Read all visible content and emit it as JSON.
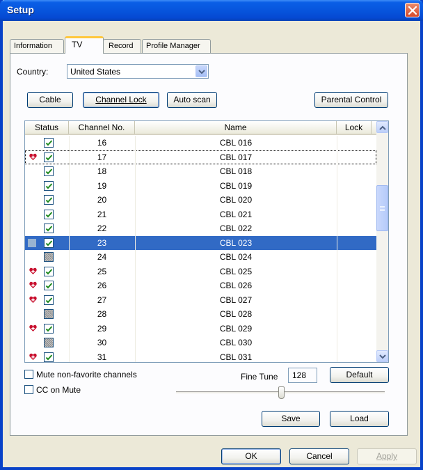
{
  "window": {
    "title": "Setup"
  },
  "tabs": [
    {
      "label": "Information"
    },
    {
      "label": "TV"
    },
    {
      "label": "Record"
    },
    {
      "label": "Profile Manager"
    }
  ],
  "country": {
    "label": "Country:",
    "value": "United States"
  },
  "buttons": {
    "cable": "Cable",
    "channel_lock": "Channel Lock",
    "auto_scan": "Auto scan",
    "parental_control": "Parental Control",
    "default": "Default",
    "save": "Save",
    "load": "Load",
    "ok": "OK",
    "cancel": "Cancel",
    "apply": "Apply"
  },
  "list": {
    "headers": {
      "status": "Status",
      "channel": "Channel No.",
      "name": "Name",
      "lock": "Lock"
    },
    "rows": [
      {
        "favorite": false,
        "checked": true,
        "channel": "16",
        "name": "CBL 016"
      },
      {
        "favorite": true,
        "checked": true,
        "channel": "17",
        "name": "CBL 017",
        "focused": true
      },
      {
        "favorite": false,
        "checked": true,
        "channel": "18",
        "name": "CBL 018"
      },
      {
        "favorite": false,
        "checked": true,
        "channel": "19",
        "name": "CBL 019"
      },
      {
        "favorite": false,
        "checked": true,
        "channel": "20",
        "name": "CBL 020"
      },
      {
        "favorite": false,
        "checked": true,
        "channel": "21",
        "name": "CBL 021"
      },
      {
        "favorite": false,
        "checked": true,
        "channel": "22",
        "name": "CBL 022"
      },
      {
        "favorite": false,
        "checked": true,
        "channel": "23",
        "name": "CBL 023",
        "selected": true
      },
      {
        "favorite": false,
        "checked": false,
        "channel": "24",
        "name": "CBL 024"
      },
      {
        "favorite": true,
        "checked": true,
        "channel": "25",
        "name": "CBL 025"
      },
      {
        "favorite": true,
        "checked": true,
        "channel": "26",
        "name": "CBL 026"
      },
      {
        "favorite": true,
        "checked": true,
        "channel": "27",
        "name": "CBL 027"
      },
      {
        "favorite": false,
        "checked": false,
        "channel": "28",
        "name": "CBL 028"
      },
      {
        "favorite": true,
        "checked": true,
        "channel": "29",
        "name": "CBL 029"
      },
      {
        "favorite": false,
        "checked": false,
        "channel": "30",
        "name": "CBL 030"
      },
      {
        "favorite": true,
        "checked": true,
        "channel": "31",
        "name": "CBL 031"
      }
    ]
  },
  "options": {
    "mute_nonfavorite": {
      "label": "Mute non-favorite channels",
      "checked": false
    },
    "cc_on_mute": {
      "label": "CC on Mute",
      "checked": false
    }
  },
  "fine_tune": {
    "label": "Fine Tune",
    "value": "128"
  },
  "colors": {
    "title_bar": "#0755dd",
    "selection": "#316ac5",
    "favorite_heart": "#c8102e",
    "check_mark": "#1f8a1f"
  },
  "icons": {
    "close": "close-icon",
    "favorite": "heart-icon",
    "check": "checkmark-icon",
    "dropdown": "chevron-down-icon"
  }
}
